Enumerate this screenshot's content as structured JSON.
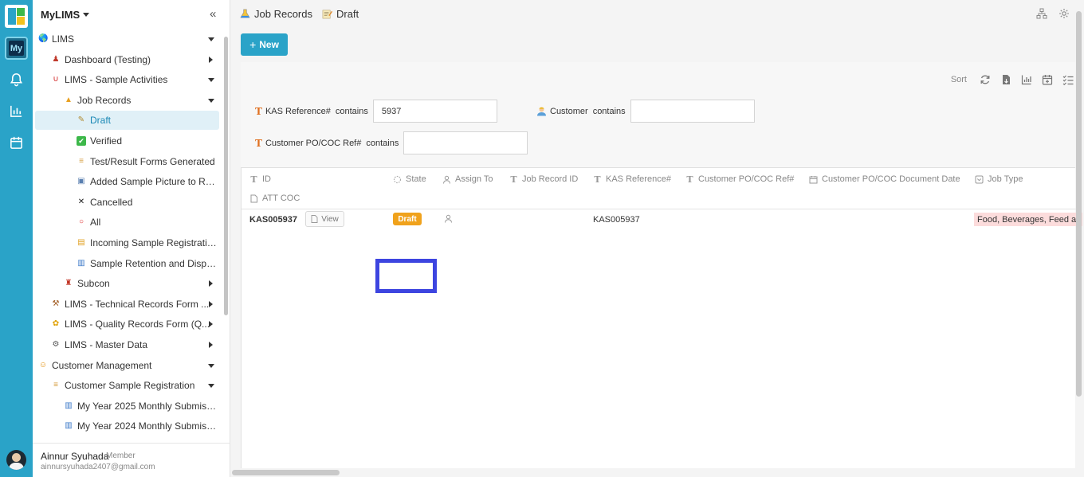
{
  "app": {
    "name": "MyLIMS",
    "my_badge": "My"
  },
  "sidebar": {
    "collapse_glyph": "«",
    "items": [
      {
        "label": "LIMS",
        "icon": "globe-icon",
        "level": 0,
        "toggle": "down"
      },
      {
        "label": "Dashboard (Testing)",
        "icon": "chart-person-icon",
        "level": 1,
        "toggle": "right"
      },
      {
        "label": "LIMS - Sample Activities",
        "icon": "magnet-icon",
        "level": 1,
        "toggle": "down"
      },
      {
        "label": "Job Records",
        "icon": "flask-icon",
        "level": 2,
        "toggle": "down"
      },
      {
        "label": "Draft",
        "icon": "memo-icon",
        "level": 3,
        "toggle": "none",
        "active": true
      },
      {
        "label": "Verified",
        "icon": "check-box-icon",
        "level": 3,
        "toggle": "none"
      },
      {
        "label": "Test/Result Forms Generated",
        "icon": "scroll-icon",
        "level": 3,
        "toggle": "none"
      },
      {
        "label": "Added Sample Picture to Rep...",
        "icon": "picture-icon",
        "level": 3,
        "toggle": "none"
      },
      {
        "label": "Cancelled",
        "icon": "cross-icon",
        "level": 3,
        "toggle": "none"
      },
      {
        "label": "All",
        "icon": "circle-icon",
        "level": 3,
        "toggle": "none"
      },
      {
        "label": "Incoming Sample Registratio...",
        "icon": "ledger-icon",
        "level": 3,
        "toggle": "none"
      },
      {
        "label": "Sample Retention and Dispos...",
        "icon": "bar-chart-icon",
        "level": 3,
        "toggle": "none"
      },
      {
        "label": "Subcon",
        "icon": "stamp-icon",
        "level": 2,
        "toggle": "right"
      },
      {
        "label": "LIMS - Technical Records Form ...",
        "icon": "tools-icon",
        "level": 1,
        "toggle": "right"
      },
      {
        "label": "LIMS - Quality Records Form (Q...",
        "icon": "sunflower-icon",
        "level": 1,
        "toggle": "right"
      },
      {
        "label": "LIMS - Master Data",
        "icon": "gear-icon",
        "level": 1,
        "toggle": "right"
      },
      {
        "label": "Customer Management",
        "icon": "smiley-icon",
        "level": 0,
        "toggle": "down"
      },
      {
        "label": "Customer Sample Registration",
        "icon": "scroll-icon",
        "level": 1,
        "toggle": "down"
      },
      {
        "label": "My Year 2025 Monthly Submissi...",
        "icon": "bar-chart-icon",
        "level": 2,
        "toggle": "none"
      },
      {
        "label": "My Year 2024 Monthly Submissi...",
        "icon": "bar-chart-icon",
        "level": 2,
        "toggle": "none"
      }
    ],
    "user": {
      "name": "Ainnur Syuhada",
      "role": "Member",
      "email": "ainnursyuhada2407@gmail.com"
    }
  },
  "breadcrumb": {
    "parent": "Job Records",
    "current": "Draft"
  },
  "toolbar": {
    "new_label": "New",
    "sort_label": "Sort"
  },
  "filters": [
    {
      "field": "KAS Reference#",
      "op": "contains",
      "value": "5937"
    },
    {
      "field": "Customer",
      "op": "contains",
      "value": ""
    },
    {
      "field": "Customer PO/COC Ref#",
      "op": "contains",
      "value": ""
    }
  ],
  "table": {
    "columns": [
      "ID",
      "State",
      "Assign To",
      "Job Record ID",
      "KAS Reference#",
      "Customer PO/COC Ref#",
      "Customer PO/COC Document Date",
      "Job Type",
      "ATT COC"
    ],
    "rows": [
      {
        "id": "KAS005937",
        "view_label": "View",
        "state": "Draft",
        "assign_to": "",
        "job_record_id": "",
        "kas_reference": "KAS005937",
        "customer_po": "",
        "doc_date": "",
        "job_type": "Food, Beverages, Feed ar"
      }
    ]
  },
  "colors": {
    "accent": "#2aa3c8",
    "draft_badge": "#f0a21c",
    "job_type_tag": "#fcdcdc",
    "highlight_box": "#3d45e0"
  }
}
